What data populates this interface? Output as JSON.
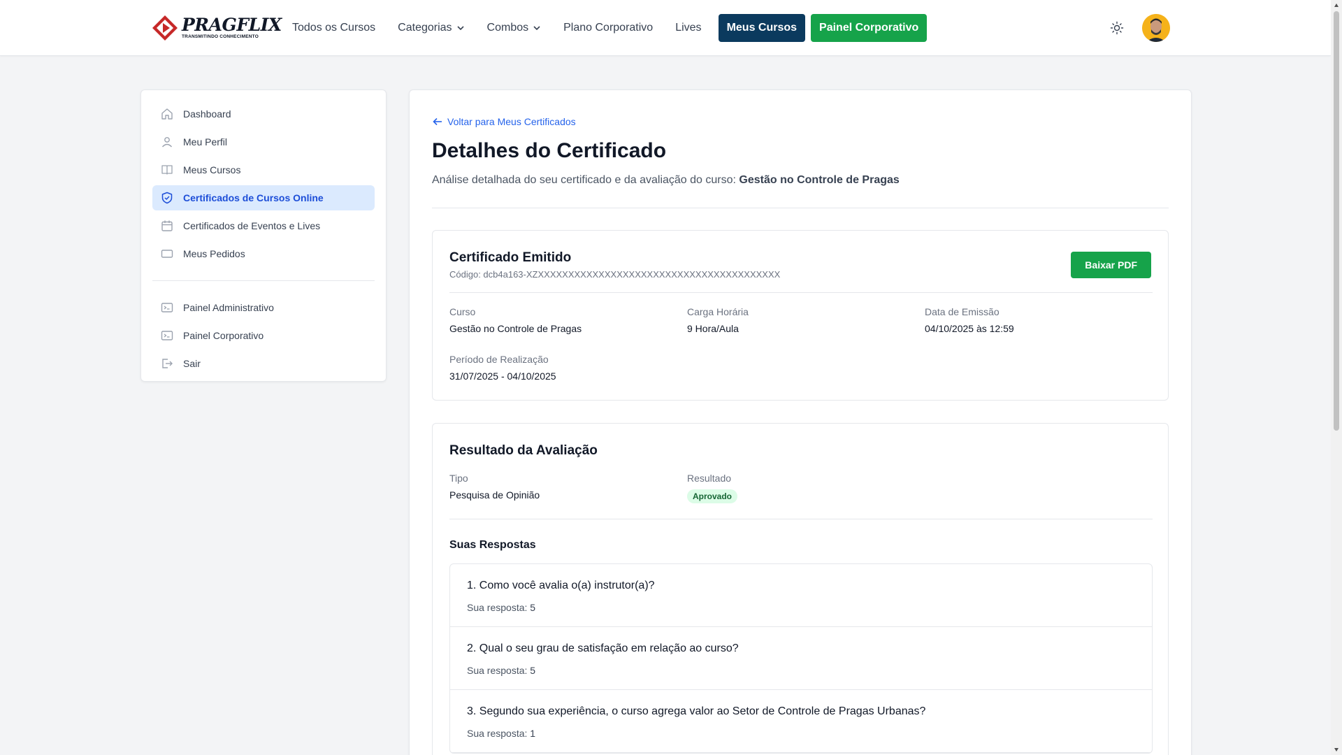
{
  "header": {
    "logo_name": "PRAGFLIX",
    "logo_tagline": "TRANSMITINDO CONHECIMENTO",
    "nav": [
      {
        "label": "Todos os Cursos"
      },
      {
        "label": "Categorias",
        "icon": "chevron-down-icon"
      },
      {
        "label": "Combos",
        "icon": "chevron-down-icon"
      },
      {
        "label": "Plano Corporativo"
      },
      {
        "label": "Lives"
      }
    ],
    "btn_meus_cursos": "Meus Cursos",
    "btn_painel_corporativo": "Painel Corporativo",
    "colors": {
      "meus_cursos_bg": "#0b3a5e",
      "painel_bg": "#16a34a"
    }
  },
  "sidebar": {
    "items": [
      {
        "label": "Dashboard",
        "icon": "home-icon"
      },
      {
        "label": "Meu Perfil",
        "icon": "user-icon"
      },
      {
        "label": "Meus Cursos",
        "icon": "book-icon"
      },
      {
        "label": "Certificados de Cursos Online",
        "icon": "shield-check-icon",
        "active": true
      },
      {
        "label": "Certificados de Eventos e Lives",
        "icon": "calendar-icon"
      },
      {
        "label": "Meus Pedidos",
        "icon": "card-icon"
      }
    ],
    "admin_items": [
      {
        "label": "Painel Administrativo",
        "icon": "terminal-icon"
      },
      {
        "label": "Painel Corporativo",
        "icon": "terminal-icon"
      },
      {
        "label": "Sair",
        "icon": "logout-icon"
      }
    ]
  },
  "main": {
    "back_link": "Voltar para Meus Certificados",
    "title": "Detalhes do Certificado",
    "subtitle_prefix": "Análise detalhada do seu certificado e da avaliação do curso:",
    "subtitle_course": "Gestão no Controle de Pragas",
    "certificate": {
      "title": "Certificado Emitido",
      "code": "Código: dcb4a163-XZXXXXXXXXXXXXXXXXXXXXXXXXXXXXXXXXXXXXXXXX",
      "download_label": "Baixar PDF",
      "fields": {
        "curso_label": "Curso",
        "curso_value": "Gestão no Controle de Pragas",
        "carga_label": "Carga Horária",
        "carga_value": "9 Hora/Aula",
        "emissao_label": "Data de Emissão",
        "emissao_value": "04/10/2025 às 12:59",
        "periodo_label": "Período de Realização",
        "periodo_value": "31/07/2025 - 04/10/2025"
      }
    },
    "evaluation": {
      "title": "Resultado da Avaliação",
      "tipo_label": "Tipo",
      "tipo_value": "Pesquisa de Opinião",
      "resultado_label": "Resultado",
      "resultado_value": "Aprovado",
      "answers_title": "Suas Respostas",
      "answer_prefix": "Sua resposta:",
      "answers": [
        {
          "question": "1. Como você avalia o(a) instrutor(a)?",
          "answer": "5"
        },
        {
          "question": "2. Qual o seu grau de satisfação em relação ao curso?",
          "answer": "5"
        },
        {
          "question": "3. Segundo sua experiência, o curso agrega valor ao Setor de Controle de Pragas Urbanas?",
          "answer": "1"
        }
      ]
    }
  }
}
